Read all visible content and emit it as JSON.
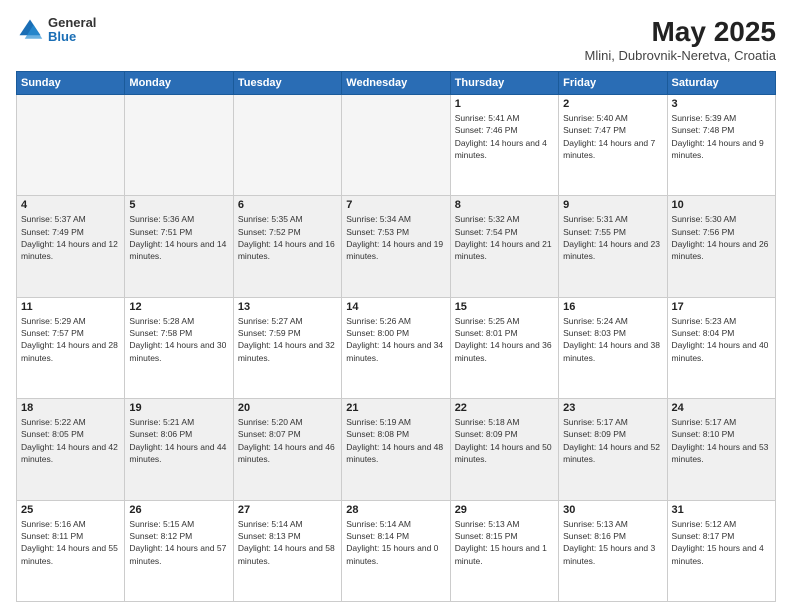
{
  "header": {
    "logo_general": "General",
    "logo_blue": "Blue",
    "main_title": "May 2025",
    "subtitle": "Mlini, Dubrovnik-Neretva, Croatia"
  },
  "days_of_week": [
    "Sunday",
    "Monday",
    "Tuesday",
    "Wednesday",
    "Thursday",
    "Friday",
    "Saturday"
  ],
  "weeks": [
    [
      {
        "day": "",
        "empty": true
      },
      {
        "day": "",
        "empty": true
      },
      {
        "day": "",
        "empty": true
      },
      {
        "day": "",
        "empty": true
      },
      {
        "day": "1",
        "sunrise": "5:41 AM",
        "sunset": "7:46 PM",
        "daylight": "14 hours and 4 minutes."
      },
      {
        "day": "2",
        "sunrise": "5:40 AM",
        "sunset": "7:47 PM",
        "daylight": "14 hours and 7 minutes."
      },
      {
        "day": "3",
        "sunrise": "5:39 AM",
        "sunset": "7:48 PM",
        "daylight": "14 hours and 9 minutes."
      }
    ],
    [
      {
        "day": "4",
        "sunrise": "5:37 AM",
        "sunset": "7:49 PM",
        "daylight": "14 hours and 12 minutes."
      },
      {
        "day": "5",
        "sunrise": "5:36 AM",
        "sunset": "7:51 PM",
        "daylight": "14 hours and 14 minutes."
      },
      {
        "day": "6",
        "sunrise": "5:35 AM",
        "sunset": "7:52 PM",
        "daylight": "14 hours and 16 minutes."
      },
      {
        "day": "7",
        "sunrise": "5:34 AM",
        "sunset": "7:53 PM",
        "daylight": "14 hours and 19 minutes."
      },
      {
        "day": "8",
        "sunrise": "5:32 AM",
        "sunset": "7:54 PM",
        "daylight": "14 hours and 21 minutes."
      },
      {
        "day": "9",
        "sunrise": "5:31 AM",
        "sunset": "7:55 PM",
        "daylight": "14 hours and 23 minutes."
      },
      {
        "day": "10",
        "sunrise": "5:30 AM",
        "sunset": "7:56 PM",
        "daylight": "14 hours and 26 minutes."
      }
    ],
    [
      {
        "day": "11",
        "sunrise": "5:29 AM",
        "sunset": "7:57 PM",
        "daylight": "14 hours and 28 minutes."
      },
      {
        "day": "12",
        "sunrise": "5:28 AM",
        "sunset": "7:58 PM",
        "daylight": "14 hours and 30 minutes."
      },
      {
        "day": "13",
        "sunrise": "5:27 AM",
        "sunset": "7:59 PM",
        "daylight": "14 hours and 32 minutes."
      },
      {
        "day": "14",
        "sunrise": "5:26 AM",
        "sunset": "8:00 PM",
        "daylight": "14 hours and 34 minutes."
      },
      {
        "day": "15",
        "sunrise": "5:25 AM",
        "sunset": "8:01 PM",
        "daylight": "14 hours and 36 minutes."
      },
      {
        "day": "16",
        "sunrise": "5:24 AM",
        "sunset": "8:03 PM",
        "daylight": "14 hours and 38 minutes."
      },
      {
        "day": "17",
        "sunrise": "5:23 AM",
        "sunset": "8:04 PM",
        "daylight": "14 hours and 40 minutes."
      }
    ],
    [
      {
        "day": "18",
        "sunrise": "5:22 AM",
        "sunset": "8:05 PM",
        "daylight": "14 hours and 42 minutes."
      },
      {
        "day": "19",
        "sunrise": "5:21 AM",
        "sunset": "8:06 PM",
        "daylight": "14 hours and 44 minutes."
      },
      {
        "day": "20",
        "sunrise": "5:20 AM",
        "sunset": "8:07 PM",
        "daylight": "14 hours and 46 minutes."
      },
      {
        "day": "21",
        "sunrise": "5:19 AM",
        "sunset": "8:08 PM",
        "daylight": "14 hours and 48 minutes."
      },
      {
        "day": "22",
        "sunrise": "5:18 AM",
        "sunset": "8:09 PM",
        "daylight": "14 hours and 50 minutes."
      },
      {
        "day": "23",
        "sunrise": "5:17 AM",
        "sunset": "8:09 PM",
        "daylight": "14 hours and 52 minutes."
      },
      {
        "day": "24",
        "sunrise": "5:17 AM",
        "sunset": "8:10 PM",
        "daylight": "14 hours and 53 minutes."
      }
    ],
    [
      {
        "day": "25",
        "sunrise": "5:16 AM",
        "sunset": "8:11 PM",
        "daylight": "14 hours and 55 minutes."
      },
      {
        "day": "26",
        "sunrise": "5:15 AM",
        "sunset": "8:12 PM",
        "daylight": "14 hours and 57 minutes."
      },
      {
        "day": "27",
        "sunrise": "5:14 AM",
        "sunset": "8:13 PM",
        "daylight": "14 hours and 58 minutes."
      },
      {
        "day": "28",
        "sunrise": "5:14 AM",
        "sunset": "8:14 PM",
        "daylight": "15 hours and 0 minutes."
      },
      {
        "day": "29",
        "sunrise": "5:13 AM",
        "sunset": "8:15 PM",
        "daylight": "15 hours and 1 minute."
      },
      {
        "day": "30",
        "sunrise": "5:13 AM",
        "sunset": "8:16 PM",
        "daylight": "15 hours and 3 minutes."
      },
      {
        "day": "31",
        "sunrise": "5:12 AM",
        "sunset": "8:17 PM",
        "daylight": "15 hours and 4 minutes."
      }
    ]
  ]
}
